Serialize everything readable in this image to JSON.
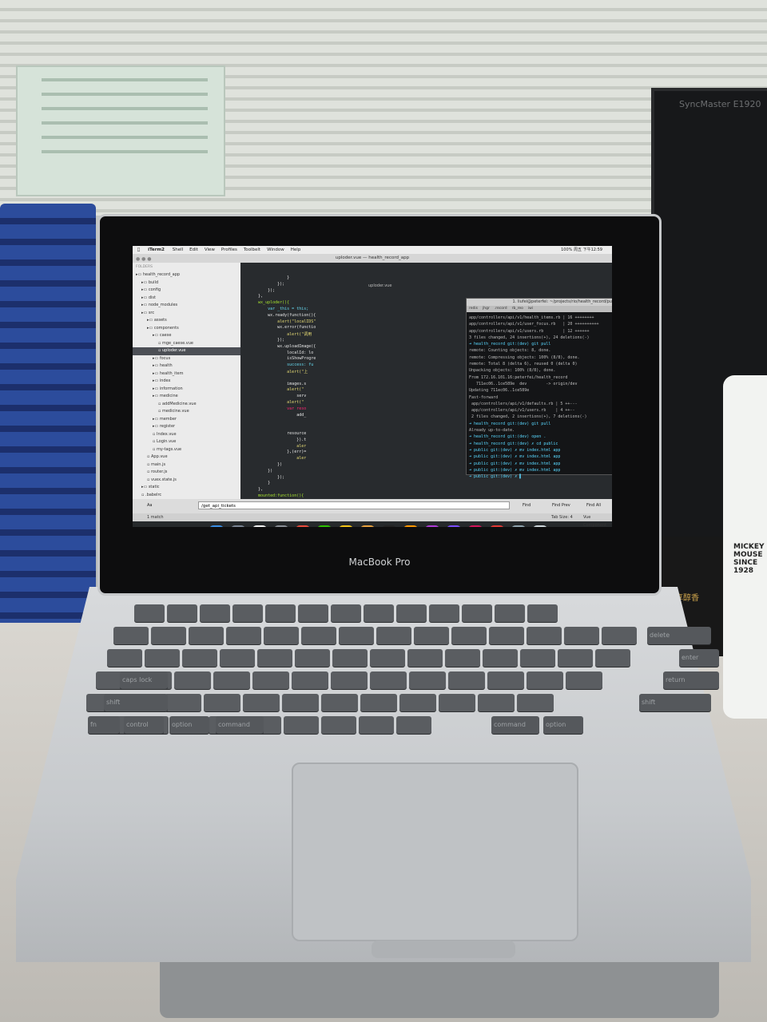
{
  "environment": {
    "monitor_brand": "SyncMaster E1920",
    "laptop_brand": "MacBook Pro",
    "bottle_text": "MICKEY MOUSE SINCE 1928",
    "box_text": "浪享醇香"
  },
  "menubar": {
    "app": "iTerm2",
    "items": [
      "Shell",
      "Edit",
      "View",
      "Profiles",
      "Toolbelt",
      "Window",
      "Help"
    ],
    "right_status": "100% 周五 下午12:59"
  },
  "window_title": "uploder.vue — health_record_app",
  "sidebar": {
    "header": "FOLDERS",
    "items": [
      {
        "label": "health_record_app",
        "depth": 0
      },
      {
        "label": "build",
        "depth": 1
      },
      {
        "label": "config",
        "depth": 1
      },
      {
        "label": "dist",
        "depth": 1
      },
      {
        "label": "node_modules",
        "depth": 1
      },
      {
        "label": "src",
        "depth": 1
      },
      {
        "label": "assets",
        "depth": 2
      },
      {
        "label": "components",
        "depth": 2
      },
      {
        "label": "caese",
        "depth": 3
      },
      {
        "label": "mge_caese.vue",
        "depth": 4
      },
      {
        "label": "uploder.vue",
        "depth": 4,
        "selected": true
      },
      {
        "label": "focus",
        "depth": 3
      },
      {
        "label": "health",
        "depth": 3
      },
      {
        "label": "health_item",
        "depth": 3
      },
      {
        "label": "index",
        "depth": 3
      },
      {
        "label": "information",
        "depth": 3
      },
      {
        "label": "medicine",
        "depth": 3
      },
      {
        "label": "addMedicine.vue",
        "depth": 4
      },
      {
        "label": "medicine.vue",
        "depth": 4
      },
      {
        "label": "member",
        "depth": 3
      },
      {
        "label": "register",
        "depth": 3
      },
      {
        "label": "Index.vue",
        "depth": 3
      },
      {
        "label": "Login.vue",
        "depth": 3
      },
      {
        "label": "my-tags.vue",
        "depth": 3
      },
      {
        "label": "App.vue",
        "depth": 2
      },
      {
        "label": "main.js",
        "depth": 2
      },
      {
        "label": "router.js",
        "depth": 2
      },
      {
        "label": "vuex.state.js",
        "depth": 2
      },
      {
        "label": "static",
        "depth": 1
      },
      {
        "label": ".babelrc",
        "depth": 1
      }
    ]
  },
  "editor": {
    "tab": "uploder.vue",
    "lines": [
      {
        "text": "                }",
        "color": "#e6e6e6"
      },
      {
        "text": "            });",
        "color": "#e6e6e6"
      },
      {
        "text": "        });",
        "color": "#e6e6e6"
      },
      {
        "text": "    },",
        "color": "#e6e6e6"
      },
      {
        "text": "    wx_uploder(){",
        "color": "#a6e22e"
      },
      {
        "text": "        var _this = this;",
        "color": "#66d9ef"
      },
      {
        "text": "        wx.ready(function(){",
        "color": "#e6e6e6"
      },
      {
        "text": "            alert(\"localIDS\"",
        "color": "#e6db74"
      },
      {
        "text": "            wx.error(functio",
        "color": "#e6e6e6"
      },
      {
        "text": "                alert(\"调用",
        "color": "#e6db74"
      },
      {
        "text": "            });",
        "color": "#e6e6e6"
      },
      {
        "text": "            wx.uploadImage({",
        "color": "#e6e6e6"
      },
      {
        "text": "                localId: lo",
        "color": "#e6e6e6"
      },
      {
        "text": "                isShowProgre",
        "color": "#e6e6e6"
      },
      {
        "text": "                success: fu",
        "color": "#66d9ef"
      },
      {
        "text": "                alert(\"上",
        "color": "#e6db74"
      },
      {
        "text": "",
        "color": "#e6e6e6"
      },
      {
        "text": "                images.s",
        "color": "#e6e6e6"
      },
      {
        "text": "                alert(\"",
        "color": "#e6db74"
      },
      {
        "text": "                    serv",
        "color": "#e6e6e6"
      },
      {
        "text": "                alert(\"",
        "color": "#e6db74"
      },
      {
        "text": "                var reso",
        "color": "#f92672"
      },
      {
        "text": "                    add_",
        "color": "#e6e6e6"
      },
      {
        "text": "",
        "color": "#e6e6e6"
      },
      {
        "text": "",
        "color": "#e6e6e6"
      },
      {
        "text": "                resource",
        "color": "#e6e6e6"
      },
      {
        "text": "                    }).t",
        "color": "#e6e6e6"
      },
      {
        "text": "                    aler",
        "color": "#e6db74"
      },
      {
        "text": "                },(err)=",
        "color": "#e6e6e6"
      },
      {
        "text": "                    aler",
        "color": "#e6db74"
      },
      {
        "text": "            })",
        "color": "#e6e6e6"
      },
      {
        "text": "        })",
        "color": "#e6e6e6"
      },
      {
        "text": "            });",
        "color": "#e6e6e6"
      },
      {
        "text": "        }",
        "color": "#e6e6e6"
      },
      {
        "text": "    },",
        "color": "#e6e6e6"
      },
      {
        "text": "    mounted:function(){",
        "color": "#a6e22e"
      }
    ]
  },
  "terminal": {
    "title": "1. liufei@peterfei: ~/projects/rio/health_record/public (zsh)",
    "tabs": [
      "redis",
      "jhgr",
      ".record",
      "rb_reo",
      "iwi"
    ],
    "lines": [
      {
        "text": "app/controllers/api/v1/health_items.rb | 16 ++++++++",
        "color": "#bdbdbd"
      },
      {
        "text": "app/controllers/api/v1/user_focus.rb   | 20 ++++++++++",
        "color": "#bdbdbd"
      },
      {
        "text": "app/controllers/api/v1/users.rb        | 12 ++++++",
        "color": "#bdbdbd"
      },
      {
        "text": "3 files changed, 24 insertions(+), 24 deletions(-)",
        "color": "#bdbdbd"
      },
      {
        "text": "➜ health_record git:(dev) git pull",
        "color": "#59d8ff"
      },
      {
        "text": "remote: Counting objects: 8, done.",
        "color": "#bdbdbd"
      },
      {
        "text": "remote: Compressing objects: 100% (8/8), done.",
        "color": "#bdbdbd"
      },
      {
        "text": "remote: Total 8 (delta 6), reused 0 (delta 0)",
        "color": "#bdbdbd"
      },
      {
        "text": "Unpacking objects: 100% (8/8), done.",
        "color": "#bdbdbd"
      },
      {
        "text": "From 172.16.101.16:peterfei/health_record",
        "color": "#bdbdbd"
      },
      {
        "text": "   711ec06..1ce589e  dev        -> origin/dev",
        "color": "#bdbdbd"
      },
      {
        "text": "Updating 711ec06..1ce589e",
        "color": "#bdbdbd"
      },
      {
        "text": "Fast-forward",
        "color": "#bdbdbd"
      },
      {
        "text": " app/controllers/api/v1/defaults.rb | 5 ++---",
        "color": "#bdbdbd"
      },
      {
        "text": " app/controllers/api/v1/users.rb    | 4 ++--",
        "color": "#bdbdbd"
      },
      {
        "text": " 2 files changed, 2 insertions(+), 7 deletions(-)",
        "color": "#bdbdbd"
      },
      {
        "text": "➜ health_record git:(dev) git pull",
        "color": "#59d8ff"
      },
      {
        "text": "Already up-to-date.",
        "color": "#bdbdbd"
      },
      {
        "text": "➜ health_record git:(dev) open .",
        "color": "#59d8ff"
      },
      {
        "text": "➜ health_record git:(dev) ✗ cd public",
        "color": "#59d8ff"
      },
      {
        "text": "➜ public git:(dev) ✗ mv index.html app",
        "color": "#59d8ff"
      },
      {
        "text": "➜ public git:(dev) ✗ mv index.html app",
        "color": "#59d8ff"
      },
      {
        "text": "➜ public git:(dev) ✗ mv index.html app",
        "color": "#59d8ff"
      },
      {
        "text": "➜ public git:(dev) ✗ mv index.html app",
        "color": "#59d8ff"
      },
      {
        "text": "➜ public git:(dev) ✗ ▌",
        "color": "#59d8ff"
      }
    ]
  },
  "findbar": {
    "value": "/get_api_tickets",
    "find_label": "Find",
    "find_prev_label": "Find Prev",
    "find_all_label": "Find All"
  },
  "statusbar": {
    "matches": "1 match",
    "tab_size": "Tab Size: 4",
    "syntax": "Vue Component"
  },
  "dock": {
    "icons": [
      "finder-icon",
      "launchpad-icon",
      "calendar-icon",
      "system-prefs-icon",
      "chrome-icon",
      "wechat-icon",
      "qq-icon",
      "sequel-icon",
      "terminal-icon",
      "sublime-icon",
      "dash-icon",
      "visual-icon",
      "rubymine-icon",
      "paw-icon",
      "preview-icon",
      "trash-icon"
    ]
  },
  "keyboard": {
    "labels": [
      "delete",
      "return",
      "enter",
      "shift",
      "shift",
      "caps lock",
      "fn",
      "control",
      "option",
      "command",
      "command",
      "option"
    ]
  }
}
